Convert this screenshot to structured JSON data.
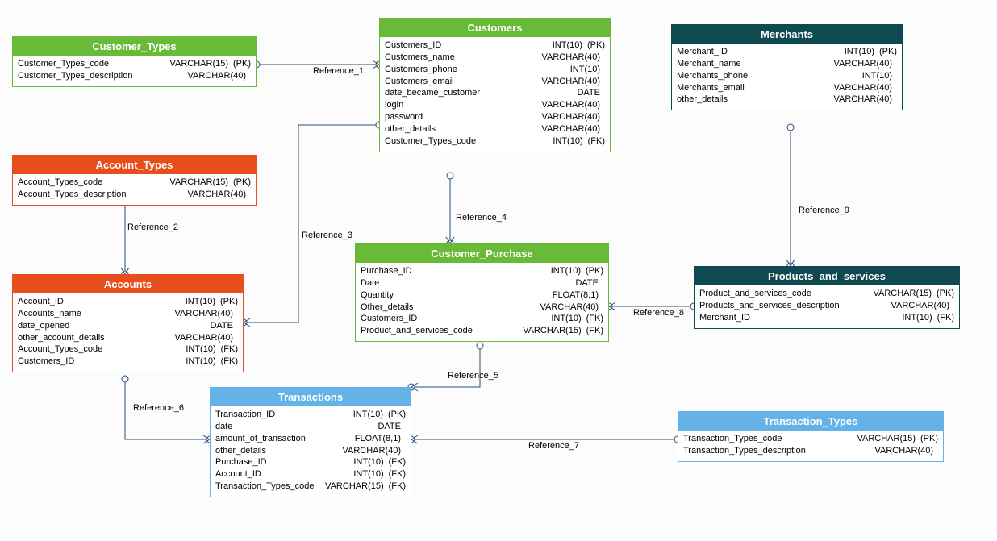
{
  "entities": {
    "customer_types": {
      "title": "Customer_Types",
      "fields": [
        {
          "name": "Customer_Types_code",
          "type": "VARCHAR(15)",
          "key": "(PK)"
        },
        {
          "name": "Customer_Types_description",
          "type": "VARCHAR(40)",
          "key": ""
        }
      ]
    },
    "account_types": {
      "title": "Account_Types",
      "fields": [
        {
          "name": "Account_Types_code",
          "type": "VARCHAR(15)",
          "key": "(PK)"
        },
        {
          "name": "Account_Types_description",
          "type": "VARCHAR(40)",
          "key": ""
        }
      ]
    },
    "accounts": {
      "title": "Accounts",
      "fields": [
        {
          "name": "Account_ID",
          "type": "INT(10)",
          "key": "(PK)"
        },
        {
          "name": "Accounts_name",
          "type": "VARCHAR(40)",
          "key": ""
        },
        {
          "name": "date_opened",
          "type": "DATE",
          "key": ""
        },
        {
          "name": "other_account_details",
          "type": "VARCHAR(40)",
          "key": ""
        },
        {
          "name": "Account_Types_code",
          "type": "INT(10)",
          "key": "(FK)"
        },
        {
          "name": "Customers_ID",
          "type": "INT(10)",
          "key": "(FK)"
        }
      ]
    },
    "customers": {
      "title": "Customers",
      "fields": [
        {
          "name": "Customers_ID",
          "type": "INT(10)",
          "key": "(PK)"
        },
        {
          "name": "Customers_name",
          "type": "VARCHAR(40)",
          "key": ""
        },
        {
          "name": "Customers_phone",
          "type": "INT(10)",
          "key": ""
        },
        {
          "name": "Customers_email",
          "type": "VARCHAR(40)",
          "key": ""
        },
        {
          "name": "date_became_customer",
          "type": "DATE",
          "key": ""
        },
        {
          "name": "login",
          "type": "VARCHAR(40)",
          "key": ""
        },
        {
          "name": "password",
          "type": "VARCHAR(40)",
          "key": ""
        },
        {
          "name": "other_details",
          "type": "VARCHAR(40)",
          "key": ""
        },
        {
          "name": "Customer_Types_code",
          "type": "INT(10)",
          "key": "(FK)"
        }
      ]
    },
    "customer_purchase": {
      "title": "Customer_Purchase",
      "fields": [
        {
          "name": "Purchase_ID",
          "type": "INT(10)",
          "key": "(PK)"
        },
        {
          "name": "Date",
          "type": "DATE",
          "key": ""
        },
        {
          "name": "Quantity",
          "type": "FLOAT(8,1)",
          "key": ""
        },
        {
          "name": "Other_details",
          "type": "VARCHAR(40)",
          "key": ""
        },
        {
          "name": "Customers_ID",
          "type": "INT(10)",
          "key": "(FK)"
        },
        {
          "name": "Product_and_services_code",
          "type": "VARCHAR(15)",
          "key": "(FK)"
        }
      ]
    },
    "merchants": {
      "title": "Merchants",
      "fields": [
        {
          "name": "Merchant_ID",
          "type": "INT(10)",
          "key": "(PK)"
        },
        {
          "name": "Merchant_name",
          "type": "VARCHAR(40)",
          "key": ""
        },
        {
          "name": "Merchants_phone",
          "type": "INT(10)",
          "key": ""
        },
        {
          "name": "Merchants_email",
          "type": "VARCHAR(40)",
          "key": ""
        },
        {
          "name": "other_details",
          "type": "VARCHAR(40)",
          "key": ""
        }
      ]
    },
    "products_and_services": {
      "title": "Products_and_services",
      "fields": [
        {
          "name": "Product_and_services_code",
          "type": "VARCHAR(15)",
          "key": "(PK)"
        },
        {
          "name": "Products_and_services_description",
          "type": "VARCHAR(40)",
          "key": ""
        },
        {
          "name": "Merchant_ID",
          "type": "INT(10)",
          "key": "(FK)"
        }
      ]
    },
    "transactions": {
      "title": "Transactions",
      "fields": [
        {
          "name": "Transaction_ID",
          "type": "INT(10)",
          "key": "(PK)"
        },
        {
          "name": "date",
          "type": "DATE",
          "key": ""
        },
        {
          "name": "amount_of_transaction",
          "type": "FLOAT(8,1)",
          "key": ""
        },
        {
          "name": "other_details",
          "type": "VARCHAR(40)",
          "key": ""
        },
        {
          "name": "Purchase_ID",
          "type": "INT(10)",
          "key": "(FK)"
        },
        {
          "name": "Account_ID",
          "type": "INT(10)",
          "key": "(FK)"
        },
        {
          "name": "Transaction_Types_code",
          "type": "VARCHAR(15)",
          "key": "(FK)"
        }
      ]
    },
    "transaction_types": {
      "title": "Transaction_Types",
      "fields": [
        {
          "name": "Transaction_Types_code",
          "type": "VARCHAR(15)",
          "key": "(PK)"
        },
        {
          "name": "Transaction_Types_description",
          "type": "VARCHAR(40)",
          "key": ""
        }
      ]
    }
  },
  "references": {
    "r1": "Reference_1",
    "r2": "Reference_2",
    "r3": "Reference_3",
    "r4": "Reference_4",
    "r5": "Reference_5",
    "r6": "Reference_6",
    "r7": "Reference_7",
    "r8": "Reference_8",
    "r9": "Reference_9"
  }
}
